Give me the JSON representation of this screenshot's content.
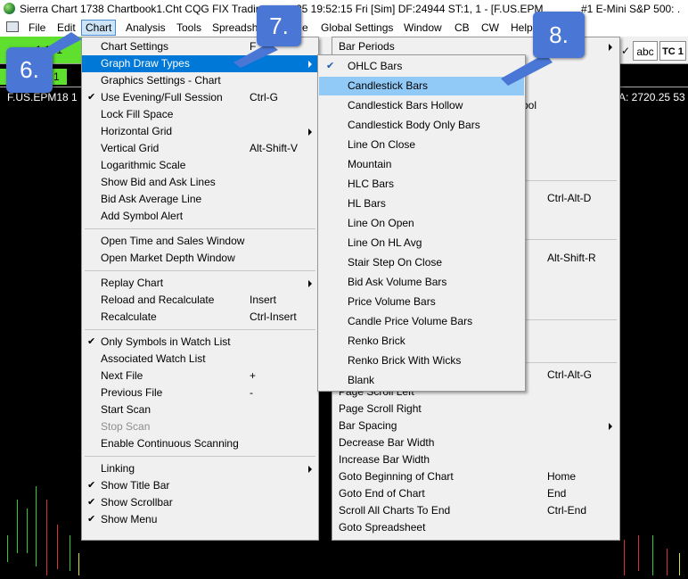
{
  "titlebar": {
    "part1": "Sierra Chart 1738 Chartbook1.Cht  CQG FIX Tradin",
    "part2": "25  19:52:15 Fri [Sim]  DF:24944  ST:1, 1 - [F.US.EPM",
    "part3": "#1  E-Mini S&P 500: ."
  },
  "menubar": {
    "items": [
      "File",
      "Edit",
      "Chart",
      "Analysis",
      "Tools",
      "Spreadsh",
      "e",
      "Global Settings",
      "Window",
      "CB",
      "CW",
      "Help"
    ]
  },
  "toolbar": {
    "green_label": "1:1, 1",
    "tab_label": "1",
    "abc_label": "abc",
    "tc_label": "TC 1"
  },
  "chart": {
    "symbol_left": "F.US.EPM18  1",
    "quote_right": "A: 2720.25  53"
  },
  "chart_menu": {
    "items": [
      {
        "label": "Chart Settings",
        "shortcut": "F",
        "check": false,
        "submenu": false
      },
      {
        "label": "Graph Draw Types",
        "shortcut": "",
        "check": false,
        "submenu": true
      },
      {
        "label": "Graphics Settings - Chart",
        "shortcut": "",
        "check": false,
        "submenu": false
      },
      {
        "label": "Use Evening/Full Session",
        "shortcut": "Ctrl-G",
        "check": true,
        "submenu": false
      },
      {
        "label": "Lock Fill Space",
        "shortcut": "",
        "check": false,
        "submenu": false
      },
      {
        "label": "Horizontal Grid",
        "shortcut": "",
        "check": false,
        "submenu": true
      },
      {
        "label": "Vertical Grid",
        "shortcut": "Alt-Shift-V",
        "check": false,
        "submenu": false
      },
      {
        "label": "Logarithmic Scale",
        "shortcut": "",
        "check": false,
        "submenu": false
      },
      {
        "label": "Show Bid and Ask Lines",
        "shortcut": "",
        "check": false,
        "submenu": false
      },
      {
        "label": "Bid Ask Average Line",
        "shortcut": "",
        "check": false,
        "submenu": false
      },
      {
        "label": "Add Symbol Alert",
        "shortcut": "",
        "check": false,
        "submenu": false
      },
      {
        "label": "Open Time and Sales Window",
        "shortcut": "",
        "check": false,
        "submenu": false
      },
      {
        "label": "Open Market Depth Window",
        "shortcut": "",
        "check": false,
        "submenu": false
      },
      {
        "label": "Replay Chart",
        "shortcut": "",
        "check": false,
        "submenu": true
      },
      {
        "label": "Reload and Recalculate",
        "shortcut": "Insert",
        "check": false,
        "submenu": false
      },
      {
        "label": "Recalculate",
        "shortcut": "Ctrl-Insert",
        "check": false,
        "submenu": false
      },
      {
        "label": "Only Symbols in Watch List",
        "shortcut": "",
        "check": true,
        "submenu": false
      },
      {
        "label": "Associated Watch List",
        "shortcut": "",
        "check": false,
        "submenu": false
      },
      {
        "label": "Next File",
        "shortcut": "+",
        "check": false,
        "submenu": false
      },
      {
        "label": "Previous File",
        "shortcut": "-",
        "check": false,
        "submenu": false
      },
      {
        "label": "Start Scan",
        "shortcut": "",
        "check": false,
        "submenu": false
      },
      {
        "label": "Stop Scan",
        "shortcut": "",
        "check": false,
        "submenu": false,
        "disabled": true
      },
      {
        "label": "Enable Continuous Scanning",
        "shortcut": "",
        "check": false,
        "submenu": false
      },
      {
        "label": "Linking",
        "shortcut": "",
        "check": false,
        "submenu": true
      },
      {
        "label": "Show Title Bar",
        "shortcut": "",
        "check": true,
        "submenu": false
      },
      {
        "label": "Show Scrollbar",
        "shortcut": "",
        "check": true,
        "submenu": false
      },
      {
        "label": "Show Menu",
        "shortcut": "",
        "check": true,
        "submenu": false
      }
    ]
  },
  "graph_menu": {
    "items": [
      {
        "label": "Bar Periods",
        "shortcut": "",
        "submenu": true
      },
      {
        "label": "bol",
        "shortcut": "",
        "submenu": false
      },
      {
        "label": "",
        "shortcut": "Ctrl-Alt-D",
        "submenu": false
      },
      {
        "label": "",
        "shortcut": "Alt-Shift-R",
        "submenu": false
      },
      {
        "label": "s",
        "shortcut": "",
        "submenu": false
      },
      {
        "label": "",
        "shortcut": "Ctrl-Alt-G",
        "submenu": false
      },
      {
        "label": "Page Scroll Left",
        "shortcut": "",
        "submenu": false
      },
      {
        "label": "Page Scroll Right",
        "shortcut": "",
        "submenu": false
      },
      {
        "label": "Bar Spacing",
        "shortcut": "",
        "submenu": true
      },
      {
        "label": "Decrease Bar Width",
        "shortcut": "",
        "submenu": false
      },
      {
        "label": "Increase Bar Width",
        "shortcut": "",
        "submenu": false
      },
      {
        "label": "Goto Beginning of Chart",
        "shortcut": "Home",
        "submenu": false
      },
      {
        "label": "Goto End of Chart",
        "shortcut": "End",
        "submenu": false
      },
      {
        "label": "Scroll All Charts To End",
        "shortcut": "Ctrl-End",
        "submenu": false
      },
      {
        "label": "Goto Spreadsheet",
        "shortcut": "",
        "submenu": false
      }
    ]
  },
  "draw_types_menu": {
    "items": [
      {
        "label": "OHLC Bars",
        "check": true
      },
      {
        "label": "Candlestick Bars",
        "check": false
      },
      {
        "label": "Candlestick Bars Hollow",
        "check": false
      },
      {
        "label": "Candlestick Body Only Bars",
        "check": false
      },
      {
        "label": "Line On Close",
        "check": false
      },
      {
        "label": "Mountain",
        "check": false
      },
      {
        "label": "HLC Bars",
        "check": false
      },
      {
        "label": "HL Bars",
        "check": false
      },
      {
        "label": "Line On Open",
        "check": false
      },
      {
        "label": "Line On HL Avg",
        "check": false
      },
      {
        "label": "Stair Step On Close",
        "check": false
      },
      {
        "label": "Bid Ask Volume Bars",
        "check": false
      },
      {
        "label": "Price Volume Bars",
        "check": false
      },
      {
        "label": "Candle Price Volume Bars",
        "check": false
      },
      {
        "label": "Renko Brick",
        "check": false
      },
      {
        "label": "Renko Brick With Wicks",
        "check": false
      },
      {
        "label": "Blank",
        "check": false
      }
    ]
  },
  "callouts": {
    "six": "6.",
    "seven": "7.",
    "eight": "8."
  },
  "colors": {
    "menu_highlight": "#0078d7",
    "submenu_highlight": "#91c9f7",
    "callout": "#4a77d6",
    "green": "#5fe02e"
  }
}
